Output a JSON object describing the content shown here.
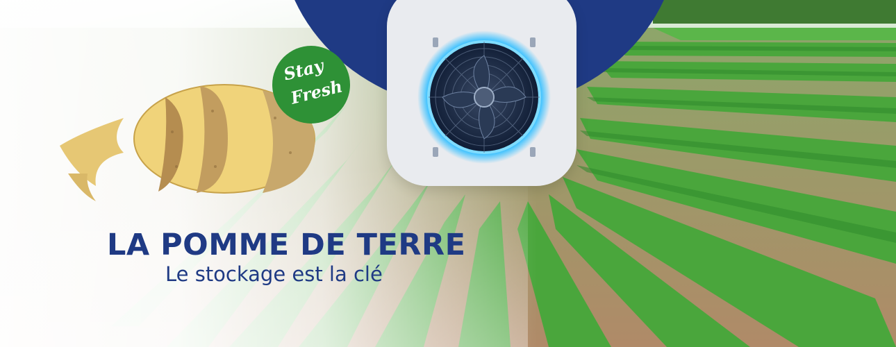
{
  "banner": {
    "headline": "LA POMME DE TERRE",
    "subline": "Le stockage est la clé",
    "badge": {
      "line1": "Stay",
      "line2": "Fresh",
      "color": "#2e9136"
    },
    "brand_color": "#1f3a84",
    "images": {
      "background": "potato-field-photo",
      "product": "peeled-potato-photo",
      "device": "ventilation-fan-icon"
    }
  }
}
